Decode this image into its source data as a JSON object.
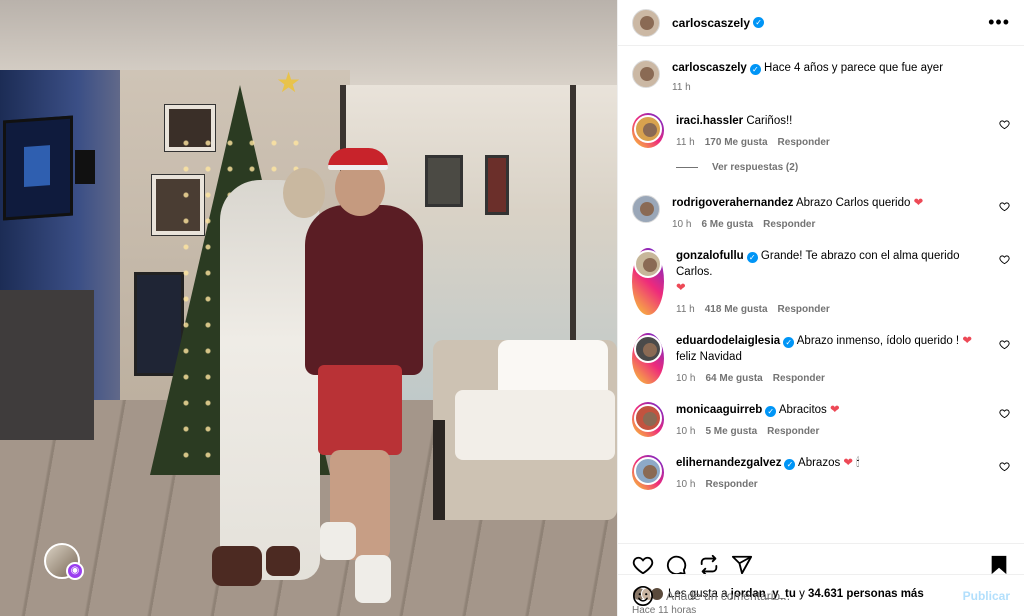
{
  "post": {
    "author": "carloscaszely",
    "caption": "Hace 4 años y parece que fue ayer",
    "caption_time": "11 h"
  },
  "comments": [
    {
      "user": "iraci.hassler",
      "verified": false,
      "text": "Cariños!!",
      "time": "11 h",
      "likes": "170 Me gusta",
      "reply": "Responder",
      "replies": "Ver respuestas (2)"
    },
    {
      "user": "rodrigoverahernandez",
      "verified": false,
      "text": "Abrazo Carlos querido",
      "emoji": "❤",
      "time": "10 h",
      "likes": "6 Me gusta",
      "reply": "Responder"
    },
    {
      "user": "gonzalofullu",
      "verified": true,
      "text": "Grande! Te abrazo con el alma querido Carlos.",
      "emoji": "❤",
      "time": "11 h",
      "likes": "418 Me gusta",
      "reply": "Responder"
    },
    {
      "user": "eduardodelaiglesia",
      "verified": true,
      "text": "Abrazo inmenso, ídolo querido !",
      "emoji": "❤",
      "text2": "feliz Navidad",
      "time": "10 h",
      "likes": "64 Me gusta",
      "reply": "Responder"
    },
    {
      "user": "monicaaguirreb",
      "verified": true,
      "text": "Abracitos",
      "emoji": "❤",
      "time": "10 h",
      "likes": "5 Me gusta",
      "reply": "Responder"
    },
    {
      "user": "elihernandezgalvez",
      "verified": true,
      "text": "Abrazos",
      "emoji": "❤",
      "emoji2": "🕯",
      "time": "10 h",
      "reply": "Responder"
    }
  ],
  "likes_bar": {
    "prefix": "Les gusta a",
    "user": "jordan_y_tu",
    "joiner": "y",
    "others": "34.631 personas más",
    "posted": "Hace 11 horas"
  },
  "composer": {
    "placeholder": "Añade un comentario...",
    "publish": "Publicar"
  },
  "icons": [
    "more-icon",
    "verified-icon",
    "heart-icon",
    "comment-icon",
    "repost-icon",
    "share-icon",
    "bookmark-icon",
    "emoji-icon",
    "reel-icon"
  ],
  "colors": {
    "link_blue": "#0095f6",
    "heart_red": "#ed4956",
    "muted": "#737373",
    "publish_disabled": "#b2dffc"
  }
}
